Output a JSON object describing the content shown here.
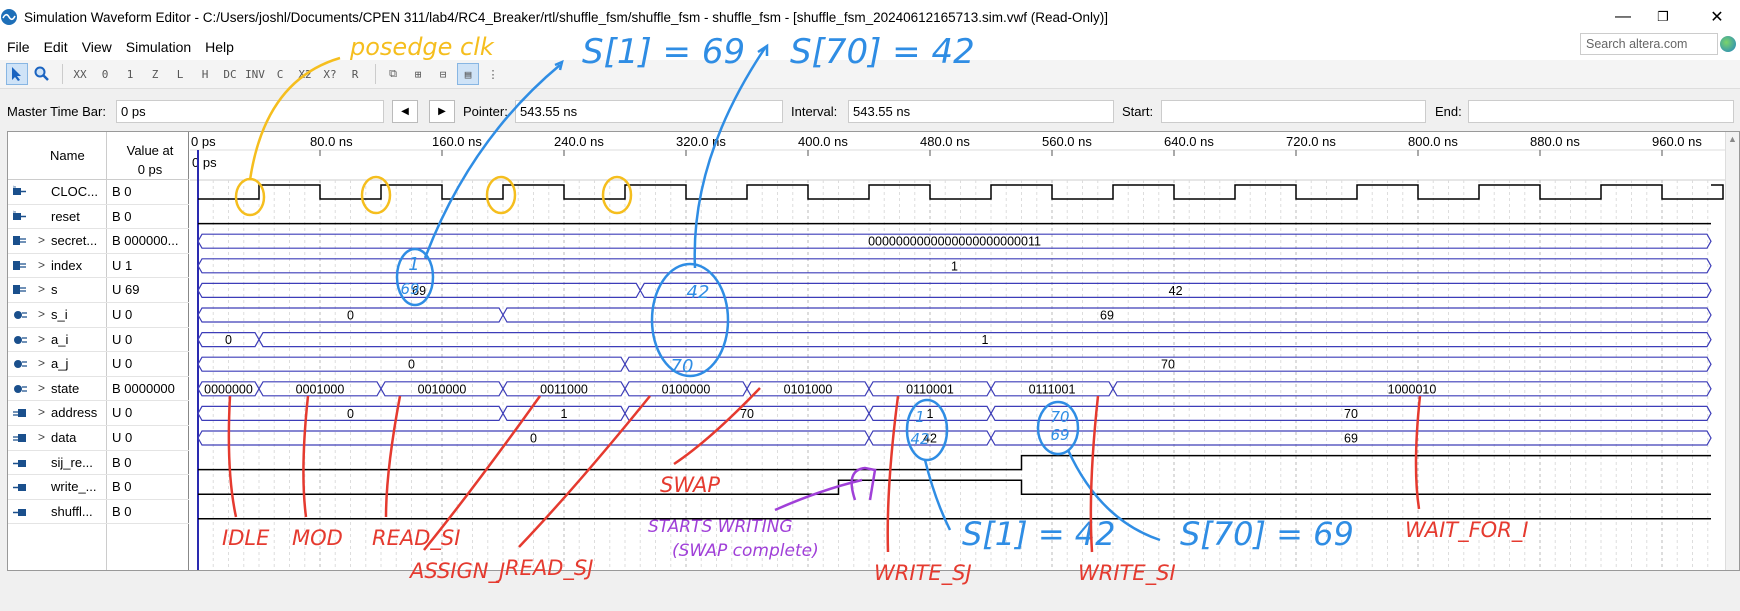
{
  "window": {
    "title": "Simulation Waveform Editor - C:/Users/joshl/Documents/CPEN 311/lab4/RC4_Breaker/rtl/shuffle_fsm/shuffle_fsm - shuffle_fsm - [shuffle_fsm_20240612165713.sim.vwf (Read-Only)]",
    "minimize": "—",
    "restore": "❐",
    "close": "✕"
  },
  "menu": [
    "File",
    "Edit",
    "View",
    "Simulation",
    "Help"
  ],
  "search": {
    "placeholder": "Search altera.com"
  },
  "timebar": {
    "master_label": "Master Time Bar:",
    "master_value": "0 ps",
    "pointer_label": "Pointer:",
    "pointer_value": "543.55 ns",
    "interval_label": "Interval:",
    "interval_value": "543.55 ns",
    "start_label": "Start:",
    "start_value": "",
    "end_label": "End:",
    "end_value": ""
  },
  "columns": {
    "name": "Name",
    "value": "Value at\n0 ps"
  },
  "time_axis": {
    "ticks": [
      "0 ps",
      "80.0 ns",
      "160.0 ns",
      "240.0 ns",
      "320.0 ns",
      "400.0 ns",
      "480.0 ns",
      "560.0 ns",
      "640.0 ns",
      "720.0 ns",
      "800.0 ns",
      "880.0 ns",
      "960.0 ns"
    ],
    "cursor_label": "0 ps"
  },
  "signals": [
    {
      "name": "CLOC...",
      "value": "B 0",
      "icon": "input-pin-icon",
      "expand": false
    },
    {
      "name": "reset",
      "value": "B 0",
      "icon": "input-pin-icon",
      "expand": false
    },
    {
      "name": "secret...",
      "value": "B 000000...",
      "icon": "input-bus-icon",
      "expand": true
    },
    {
      "name": "index",
      "value": "U 1",
      "icon": "input-bus-icon",
      "expand": true
    },
    {
      "name": "s",
      "value": "U 69",
      "icon": "input-bus-icon",
      "expand": true
    },
    {
      "name": "s_i",
      "value": "U 0",
      "icon": "buried-bus-icon",
      "expand": true
    },
    {
      "name": "a_i",
      "value": "U 0",
      "icon": "buried-bus-icon",
      "expand": true
    },
    {
      "name": "a_j",
      "value": "U 0",
      "icon": "buried-bus-icon",
      "expand": true
    },
    {
      "name": "state",
      "value": "B 0000000",
      "icon": "buried-bus-icon",
      "expand": true
    },
    {
      "name": "address",
      "value": "U 0",
      "icon": "output-bus-icon",
      "expand": true
    },
    {
      "name": "data",
      "value": "U 0",
      "icon": "output-bus-icon",
      "expand": true
    },
    {
      "name": "sij_re...",
      "value": "B 0",
      "icon": "output-pin-icon",
      "expand": false
    },
    {
      "name": "write_...",
      "value": "B 0",
      "icon": "output-pin-icon",
      "expand": false
    },
    {
      "name": "shuffl...",
      "value": "B 0",
      "icon": "output-pin-icon",
      "expand": false
    }
  ],
  "bus_values": {
    "secret": [
      "0000000000000000000000011"
    ],
    "index": [
      "1"
    ],
    "s": [
      "69",
      "42"
    ],
    "s_i": [
      "0",
      "69"
    ],
    "a_i": [
      "0",
      "1"
    ],
    "a_j": [
      "0",
      "70"
    ],
    "state": [
      "0000000",
      "0001000",
      "0010000",
      "0011000",
      "0100000",
      "0101000",
      "0110001",
      "0111001",
      "1000010"
    ],
    "address": [
      "0",
      "1",
      "70",
      "1",
      "70"
    ],
    "data": [
      "0",
      "42",
      "69"
    ]
  },
  "annotations": {
    "posedge": "posedge clk",
    "s1_69": "S[1] = 69",
    "s70_42": "S[70] = 42",
    "s1_42": "S[1] = 42",
    "s70_69": "S[70] = 69",
    "circle_index": "1",
    "circle_s": "69",
    "circle_s42": "42",
    "circle_aj": "70",
    "circle_addr": "1",
    "circle_data": "42",
    "circle_addr2": "70",
    "circle_data2": "69",
    "starts_writing_1": "STARTS WRITING",
    "starts_writing_2": "(SWAP complete)",
    "states": [
      "IDLE",
      "MOD",
      "READ_SI",
      "ASSIGN_J",
      "READ_SJ",
      "SWAP",
      "WRITE_SJ",
      "WRITE_SI",
      "WAIT_FOR_I"
    ]
  },
  "colors": {
    "wave": "#000000",
    "bus": "#3d3db8",
    "yellow": "#f5be1e",
    "blue": "#2f8de4",
    "red": "#e53a2f",
    "purple": "#a040d8"
  }
}
